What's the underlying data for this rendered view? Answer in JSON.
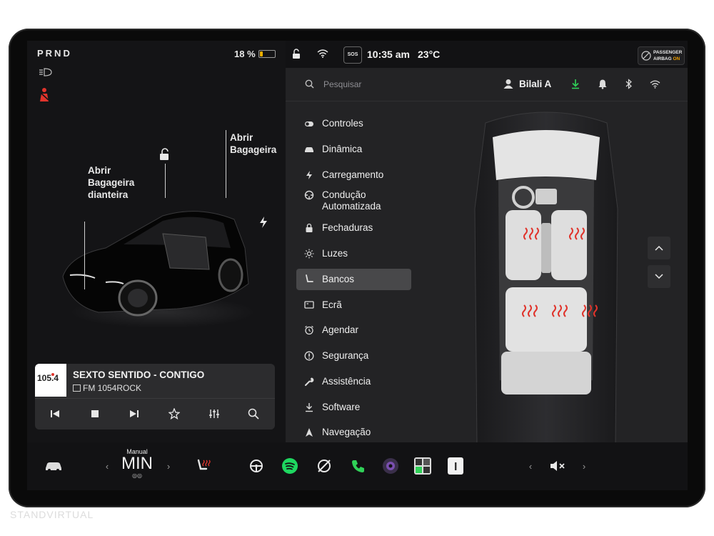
{
  "status": {
    "gear": "PRND",
    "battery": "18 %",
    "battery_fraction": 0.18,
    "time": "10:35 am",
    "temperature": "23°C",
    "sos": "SOS",
    "airbag_line1": "PASSENGER",
    "airbag_line2": "AIRBAG",
    "airbag_state": "ON"
  },
  "car": {
    "label_front_trunk_1": "Abrir",
    "label_front_trunk_2": "Bagageira",
    "label_front_trunk_3": "dianteira",
    "label_rear_trunk_1": "Abrir",
    "label_rear_trunk_2": "Bagageira"
  },
  "media": {
    "station_logo": "105.4",
    "title": "SEXTO SENTIDO - CONTIGO",
    "subtitle": "FM 1054ROCK"
  },
  "header": {
    "search_placeholder": "Pesquisar",
    "user": "Bilali A"
  },
  "menu": [
    {
      "label": "Controles",
      "icon": "toggle-icon"
    },
    {
      "label": "Dinâmica",
      "icon": "car-icon"
    },
    {
      "label": "Carregamento",
      "icon": "bolt-icon"
    },
    {
      "label": "Condução",
      "label2": "Automatizada",
      "icon": "steering-wheel-icon"
    },
    {
      "label": "Fechaduras",
      "icon": "lock-icon"
    },
    {
      "label": "Luzes",
      "icon": "sun-icon"
    },
    {
      "label": "Bancos",
      "icon": "seat-icon",
      "active": true
    },
    {
      "label": "Ecrã",
      "icon": "display-icon"
    },
    {
      "label": "Agendar",
      "icon": "alarm-icon"
    },
    {
      "label": "Segurança",
      "icon": "alert-icon"
    },
    {
      "label": "Assistência",
      "icon": "wrench-icon"
    },
    {
      "label": "Software",
      "icon": "download-icon"
    },
    {
      "label": "Navegação",
      "icon": "navigation-icon"
    }
  ],
  "dock": {
    "climate_mode": "Manual",
    "fan_speed": "MIN"
  },
  "colors": {
    "accent_green": "#30d158",
    "heat_red": "#e0342c",
    "battery_yellow": "#f0b000"
  },
  "watermark": "STANDVIRTUAL"
}
